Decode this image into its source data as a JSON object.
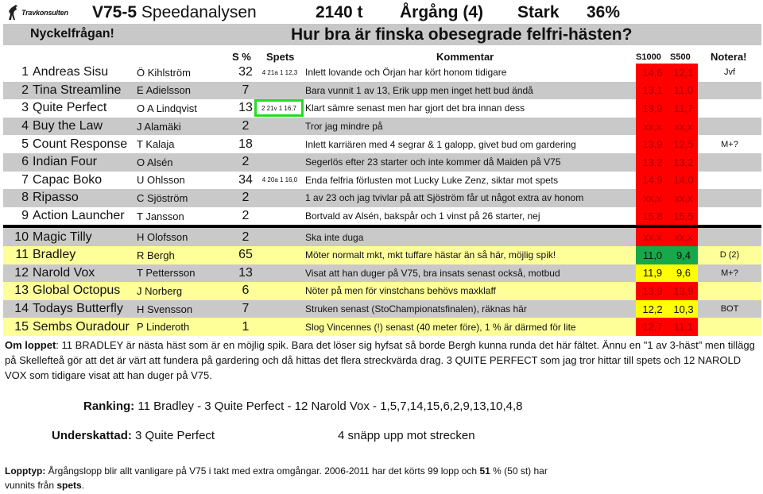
{
  "header": {
    "logo_text": "Travkonsulten",
    "race_code": "V75-5",
    "race_title": "Speedanalysen",
    "distance": "2140 t",
    "race_type": "Årgång (4)",
    "strength": "Stark",
    "percent": "36%"
  },
  "question": {
    "label": "Nyckelfrågan!",
    "text": "Hur bra är finska obesegrade felfri-hästen?"
  },
  "columns": {
    "sp": "S %",
    "spets": "Spets",
    "comment": "Kommentar",
    "s1000": "S1000",
    "s500": "S500",
    "note": "Notera!"
  },
  "colors": {
    "row_gray": "#c9c9c9",
    "row_yellow": "#ffff99",
    "speed_red": "#ff0000",
    "speed_green": "#16a84a",
    "speed_yellow": "#ffff00",
    "highlight_border": "#22dd22"
  },
  "horses": [
    {
      "no": "1",
      "name": "Andreas Sisu",
      "driver": "Ö Kihlström",
      "sp": "32",
      "spets": "4 21a 1 12,3",
      "comment": "Inlett lovande och Örjan har kört honom tidigare",
      "s1000": "14,6",
      "s500": "12,1",
      "speed_status": "red",
      "note": "Jvf"
    },
    {
      "no": "2",
      "name": "Tina Streamline",
      "driver": "E Adielsson",
      "sp": "7",
      "spets": "",
      "comment": "Bara vunnit 1 av 13, Erik upp men inget hett bud ändå",
      "s1000": "13,1",
      "s500": "11,0",
      "speed_status": "red",
      "note": ""
    },
    {
      "no": "3",
      "name": "Quite Perfect",
      "driver": "O A Lindqvist",
      "sp": "13",
      "spets": "2 21v 1 16,7",
      "spets_highlighted": true,
      "comment": "Klart sämre senast men har gjort det bra innan dess",
      "s1000": "13,9",
      "s500": "11,7",
      "speed_status": "red",
      "note": ""
    },
    {
      "no": "4",
      "name": "Buy the Law",
      "driver": "J Alamäki",
      "sp": "2",
      "spets": "",
      "comment": "Tror jag mindre på",
      "s1000": "xx,x",
      "s500": "xx,x",
      "speed_status": "red",
      "note": ""
    },
    {
      "no": "5",
      "name": "Count Response",
      "driver": "T Kalaja",
      "sp": "18",
      "spets": "",
      "comment": "Inlett karriären med 4 segrar & 1 galopp, givet bud om gardering",
      "s1000": "13,9",
      "s500": "12,5",
      "speed_status": "red",
      "note": "M+?"
    },
    {
      "no": "6",
      "name": "Indian Four",
      "driver": "O Alsén",
      "sp": "2",
      "spets": "",
      "comment": "Segerlös efter 23 starter och inte kommer då Maiden på V75",
      "s1000": "13,2",
      "s500": "13,2",
      "speed_status": "red",
      "note": ""
    },
    {
      "no": "7",
      "name": "Capac Boko",
      "driver": "U Ohlsson",
      "sp": "34",
      "spets": "4 20a 1 16,0",
      "comment": "Enda felfria förlusten mot Lucky Luke Zenz, siktar mot spets",
      "s1000": "14,9",
      "s500": "14,0",
      "speed_status": "red",
      "note": ""
    },
    {
      "no": "8",
      "name": "Ripasso",
      "driver": "C Sjöström",
      "sp": "2",
      "spets": "",
      "comment": "1 av 23 och jag tvivlar på att Sjöström får ut något extra av honom",
      "s1000": "xx,x",
      "s500": "xx,x",
      "speed_status": "red",
      "note": ""
    },
    {
      "no": "9",
      "name": "Action Launcher",
      "driver": "T Jansson",
      "sp": "2",
      "spets": "",
      "comment": "Bortvald av Alsén, bakspår och 1 vinst på 26 starter, nej",
      "s1000": "15,8",
      "s500": "15,5",
      "speed_status": "red",
      "note": ""
    },
    {
      "no": "10",
      "name": "Magic Tilly",
      "driver": "H Olofsson",
      "sp": "2",
      "spets": "",
      "comment": "Ska inte duga",
      "s1000": "xx,x",
      "s500": "xx,x",
      "speed_status": "red",
      "note": ""
    },
    {
      "no": "11",
      "name": "Bradley",
      "driver": "R Bergh",
      "sp": "65",
      "spets": "",
      "comment": "Möter normalt mkt, mkt tuffare hästar än så här, möjlig spik!",
      "s1000": "11,0",
      "s500": "9,4",
      "speed_status": "green",
      "note": "D (2)"
    },
    {
      "no": "12",
      "name": "Narold Vox",
      "driver": "T Pettersson",
      "sp": "13",
      "spets": "",
      "comment": "Visat att han duger på V75, bra insats senast också, motbud",
      "s1000": "11,9",
      "s500": "9,6",
      "speed_status": "yellow",
      "note": "M+?"
    },
    {
      "no": "13",
      "name": "Global Octopus",
      "driver": "J Norberg",
      "sp": "6",
      "spets": "",
      "comment": "Nöter på men för vinstchans behövs maxklaff",
      "s1000": "13,9",
      "s500": "13,9",
      "speed_status": "red",
      "note": ""
    },
    {
      "no": "14",
      "name": "Todays Butterfly",
      "driver": "H Svensson",
      "sp": "7",
      "spets": "",
      "comment": "Struken senast (StoChampionatsfinalen), räknas här",
      "s1000": "12,2",
      "s500": "10,3",
      "speed_status": "yellow",
      "note": "BOT"
    },
    {
      "no": "15",
      "name": "Sembs Ouradour",
      "driver": "P Linderoth",
      "sp": "1",
      "spets": "",
      "comment": "Slog Vincennes (!) senast (40 meter före), 1 % är därmed för lite",
      "s1000": "12,7",
      "s500": "11,1",
      "speed_status": "red",
      "note": ""
    }
  ],
  "about_race": {
    "label": "Om loppet",
    "text": ": 11 BRADLEY är nästa häst som är en möjlig spik. Bara det löser sig hyfsat så borde Bergh kunna runda det här fältet. Ännu en \"1 av 3-häst\" men tillägg på Skellefteå gör att det är värt att fundera på gardering och då hittas det flera streckvärda drag. 3 QUITE PERFECT som jag tror hittar till spets och 12 NAROLD VOX som tidigare visat att han duger på V75."
  },
  "ranking": {
    "label": "Ranking:",
    "value": "11 Bradley - 3 Quite Perfect - 12 Narold Vox - 1,5,7,14,15,6,2,9,13,10,4,8"
  },
  "underrated": {
    "label": "Underskattad:",
    "value": "3 Quite Perfect",
    "extra": "4 snäpp upp mot strecken"
  },
  "race_type_note": {
    "label": "Lopptyp:",
    "text1": " Årgångslopp blir allt vanligare på V75 i takt med extra omgångar. 2006-2011 har det körts 99 lopp och ",
    "bold1": "51",
    "text2": " % (50 st) har vunnits från ",
    "bold2": "spets",
    "text3": "."
  }
}
